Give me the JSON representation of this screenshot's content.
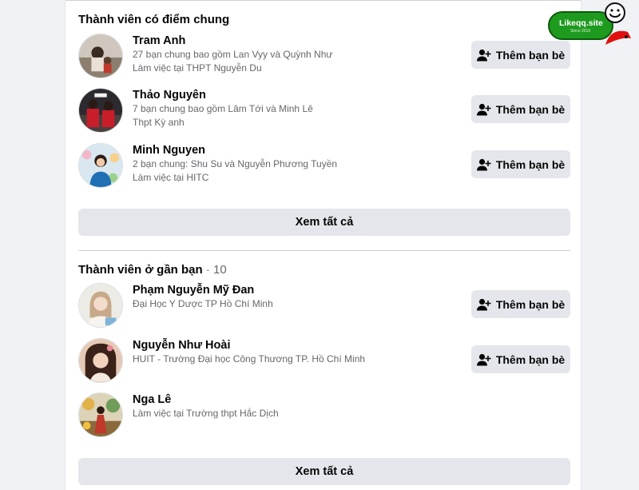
{
  "sections": [
    {
      "title": "Thành viên có điểm chung",
      "count": "",
      "members": [
        {
          "name": "Tram Anh",
          "line1": "27 bạn chung bao gồm Lan Vyy và Quỳnh Như",
          "line2": "Làm việc tại THPT Nguyễn Du",
          "button": "Thêm bạn bè"
        },
        {
          "name": "Thảo Nguyên",
          "line1": "7 bạn chung bao gồm Lâm Tới và Minh Lê",
          "line2": "Thpt Kỳ anh",
          "button": "Thêm bạn bè"
        },
        {
          "name": "Minh Nguyen",
          "line1": "2 bạn chung: Shu Su và Nguyễn Phương Tuyền",
          "line2": "Làm việc tại HITC",
          "button": "Thêm bạn bè"
        }
      ],
      "see_all": "Xem tất cả"
    },
    {
      "title": "Thành viên ở gần bạn",
      "count": " · 10",
      "members": [
        {
          "name": "Phạm Nguyễn Mỹ Đan",
          "line1": "Đại Học Y Dược TP Hồ Chí Minh",
          "line2": "",
          "button": "Thêm bạn bè"
        },
        {
          "name": "Nguyễn Như Hoài",
          "line1": "HUIT - Trường Đại học Công Thương TP. Hồ Chí Minh",
          "line2": "",
          "button": "Thêm bạn bè"
        },
        {
          "name": "Nga Lê",
          "line1": "Làm việc tại Trường thpt Hắc Dịch",
          "line2": "",
          "button": ""
        }
      ],
      "see_all": "Xem tất cả"
    }
  ],
  "watermark": {
    "text": "Likeqq.site",
    "sub": "Since 2019"
  },
  "icons": {
    "add_friend": "add-friend-icon",
    "smile": "smiley-icon"
  },
  "colors": {
    "page_bg": "#f0f2f5",
    "button_bg": "#e4e6eb",
    "secondary_text": "#65676b",
    "watermark_green": "#1e9a1e",
    "watermark_red": "#e01010"
  }
}
